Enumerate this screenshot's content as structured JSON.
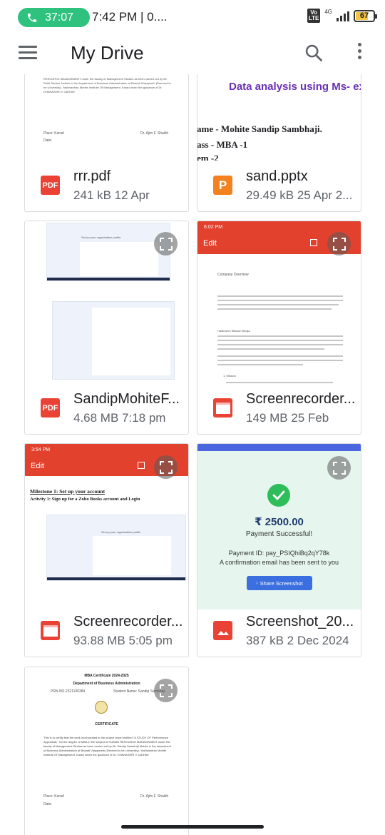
{
  "status_bar": {
    "call_duration": "37:07",
    "time_text": "7:42 PM | 0....",
    "network": "4G",
    "volte": "Vo LTE",
    "battery": "67"
  },
  "app_bar": {
    "title": "My Drive"
  },
  "files": [
    {
      "name": "rrr.pdf",
      "subtitle": "241 kB 12 Apr",
      "type_icon": "pdf-icon",
      "icon_label": "PDF",
      "preview": {
        "text_top": "RESOURCE MANAGEMENT under the faculty of Management Studies as been carried out by Mr. Rohit Sadam Jadhav in the department of Business Administration at Bharati Vidyapeeth (Deemed to be University), Yashwantrao Mohite Institute Of Management, Karad under the guidance of Dr. DHANASHRI V JADHAV",
        "place": "Place: Karad",
        "date": "Date:",
        "signer": "Dr. Ajim F. Shaikh"
      }
    },
    {
      "name": "sand.pptx",
      "subtitle": "29.49 kB 25 Apr 2...",
      "type_icon": "slides-icon",
      "icon_label": "P",
      "preview": {
        "heading": "Data analysis using Ms- ex",
        "line1": "ame - Mohite Sandip Sambhaji.",
        "line2": "ass - MBA -1",
        "line3": "em -2"
      }
    },
    {
      "name": "SandipMohiteF...",
      "subtitle": "4.68 MB 7:18 pm",
      "type_icon": "pdf-icon",
      "icon_label": "PDF",
      "preview": {
        "label": "Set up your organization profile"
      }
    },
    {
      "name": "Screenrecorder...",
      "subtitle": "149 MB 25 Feb",
      "type_icon": "video-icon",
      "icon_label": "",
      "preview": {
        "time": "6:02 PM",
        "edit_label": "Edit",
        "section": "Company Overview",
        "subhead": "Haldiram's Mission Bhujia",
        "bullet": "1. Mission"
      }
    },
    {
      "name": "Screenrecorder...",
      "subtitle": "93.88 MB 5:05 pm",
      "type_icon": "video-icon",
      "icon_label": "",
      "preview": {
        "time": "3:54 PM",
        "edit_label": "Edit",
        "milestone": "Milestone 1: Set up your account",
        "activity": "Activity 1: Sign up for a Zoho Books account and Login",
        "label": "Set up your organization profile"
      }
    },
    {
      "name": "Screenshot_20...",
      "subtitle": "387 kB 2 Dec 2024",
      "type_icon": "image-icon",
      "icon_label": "",
      "preview": {
        "amount": "₹ 2500.00",
        "status": "Payment Successful!",
        "payment_id": "Payment ID: pay_PSIQhiBq2qY78k",
        "email_note": "A confirmation email has been sent to you",
        "share_label": "Share Screenshot"
      }
    },
    {
      "name": "",
      "subtitle": "",
      "preview": {
        "heading": "MBA Certificate 2024-2025",
        "dept": "Department of Business Administration",
        "prn": "PRN NO.2321100384",
        "student": "Student Name: Sandip Sambhaji",
        "cert_title": "CERTIFICATE",
        "body": "This is to certify that the work incorporated in the project report entitled \"A STUDY OF Performance Appraisals \" for the degree of MBA in the subject of HUMAN RESOURCE MANAGEMENT under the faculty of Management Studies as been carried out by Mr. Sandip Sambhaji Mohite in the department of Business Administration at Bharati Vidyapeeth (Deemed to be University), Yashwantrao Mohite Institute Of Management, Karad under the guidance of Dr. DHANASHRI V JADHAV",
        "place": "Place: Karad",
        "date": "Date:",
        "signer": "Dr. Ajim F. Shaikh"
      }
    }
  ],
  "colors": {
    "pdf": "#ea4335",
    "slides": "#f4811f",
    "video": "#ea4335",
    "image": "#ea4335",
    "recorder_bar": "#e2412e",
    "payment_bg": "#e6f6ef",
    "success": "#2ebd59",
    "share_button": "#3b6fe0",
    "slide_heading": "#6a2fb5"
  }
}
